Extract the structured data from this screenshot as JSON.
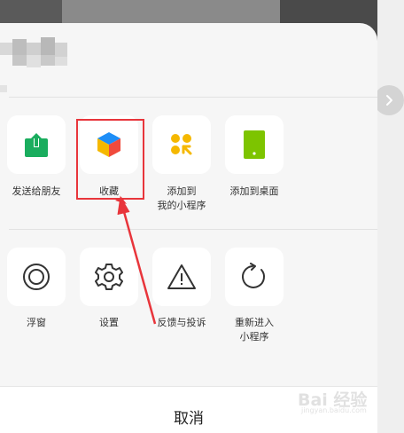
{
  "menu": {
    "row1": [
      {
        "label_lines": [
          "发送给朋友"
        ],
        "icon": "share-upload-icon"
      },
      {
        "label_lines": [
          "收藏"
        ],
        "icon": "favorite-cube-icon"
      },
      {
        "label_lines": [
          "添加到",
          "我的小程序"
        ],
        "icon": "my-miniprogram-icon"
      },
      {
        "label_lines": [
          "添加到桌面"
        ],
        "icon": "add-to-desktop-icon"
      }
    ],
    "row2": [
      {
        "label_lines": [
          "浮窗"
        ],
        "icon": "floating-window-icon"
      },
      {
        "label_lines": [
          "设置"
        ],
        "icon": "gear-icon"
      },
      {
        "label_lines": [
          "反馈与投诉"
        ],
        "icon": "warning-triangle-icon"
      },
      {
        "label_lines": [
          "重新进入",
          "小程序"
        ],
        "icon": "refresh-icon"
      }
    ]
  },
  "cancel_label": "取消",
  "watermark": {
    "text": "Bai 经验",
    "url": "jingyan.baidu.com"
  },
  "colors": {
    "share_green": "#1aad5e",
    "mini_yellow": "#f5b800",
    "desktop_green": "#7dc400",
    "highlight_red": "#e8353b"
  }
}
